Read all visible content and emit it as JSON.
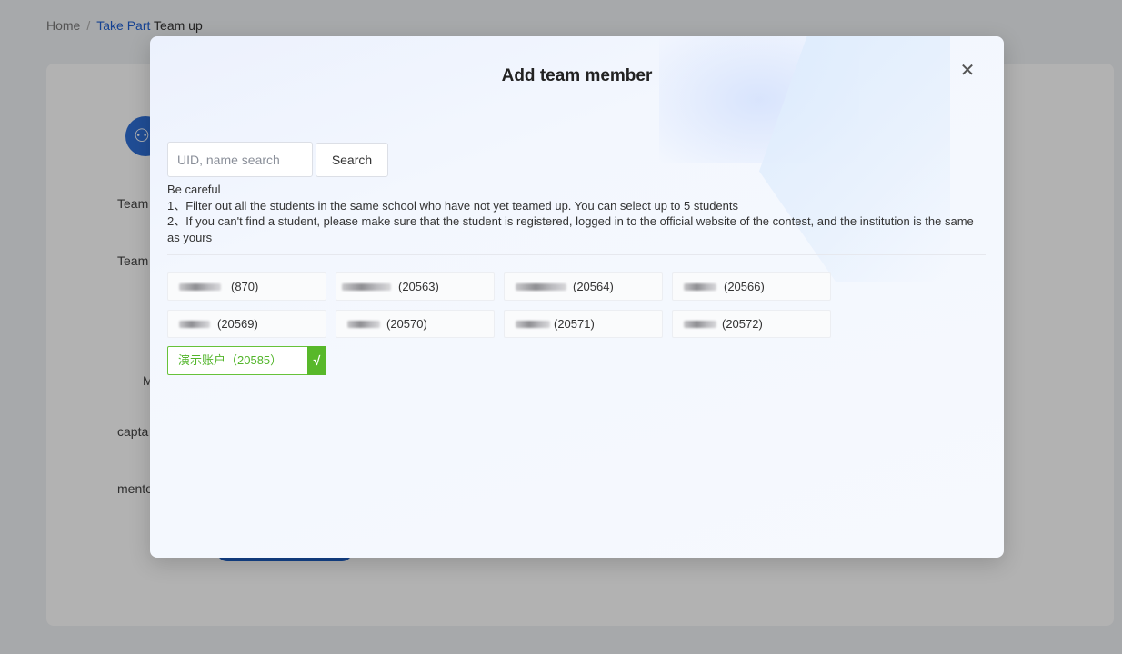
{
  "breadcrumb": {
    "home": "Home",
    "separator": "/",
    "take_part": "Take Part",
    "current": "Team up"
  },
  "background": {
    "labels": [
      "Team",
      "Team",
      "M",
      "capta",
      "mento"
    ],
    "avatar_icon": "people-icon"
  },
  "modal": {
    "title": "Add team member",
    "close_icon": "close-icon",
    "search_placeholder": "UID, name search",
    "search_value": "",
    "search_button": "Search",
    "notes": {
      "heading": "Be careful",
      "line1": "1、Filter out all the students in the same school who have not yet teamed up. You can select up to 5 students",
      "line2": "2、If you can't find a student, please make sure that the student is registered, logged in to the official website of the contest, and the institution is the same as yours"
    },
    "students": [
      {
        "uid": "(870)"
      },
      {
        "uid": "(20563)"
      },
      {
        "uid": "(20564)"
      },
      {
        "uid": "(20566)"
      },
      {
        "uid": "(20569)"
      },
      {
        "uid": "(20570)"
      },
      {
        "uid": "(20571)"
      },
      {
        "uid": "(20572)"
      }
    ],
    "selected": {
      "label": "演示账户（20585）",
      "check": "√"
    }
  },
  "colors": {
    "link": "#1f5fd1",
    "selected_green": "#58b82a",
    "background_button": "#1e5fc8"
  }
}
